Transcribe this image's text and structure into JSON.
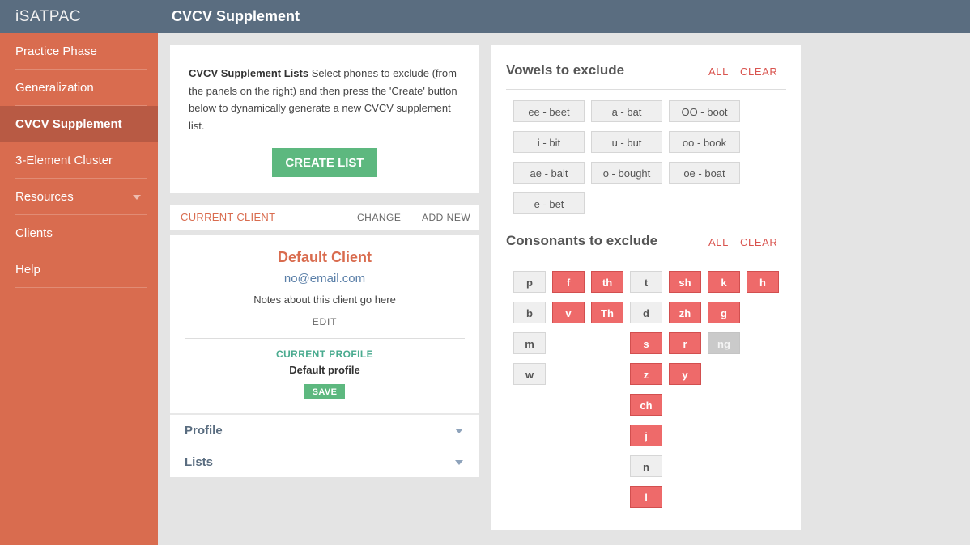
{
  "app": {
    "brand": "iSATPAC",
    "page_title": "CVCV Supplement"
  },
  "sidebar": {
    "items": [
      {
        "label": "Practice Phase",
        "active": false
      },
      {
        "label": "Generalization",
        "active": false
      },
      {
        "label": "CVCV Supplement",
        "active": true
      },
      {
        "label": "3-Element Cluster",
        "active": false
      },
      {
        "label": "Resources",
        "active": false,
        "has_dropdown": true
      },
      {
        "label": "Clients",
        "active": false
      },
      {
        "label": "Help",
        "active": false
      }
    ]
  },
  "intro": {
    "heading": "CVCV Supplement Lists",
    "body": " Select phones to exclude (from the panels on the right) and then press the 'Create' button below to dynamically generate a new CVCV supplement list.",
    "create_label": "CREATE LIST"
  },
  "client_bar": {
    "label": "CURRENT CLIENT",
    "change_label": "CHANGE",
    "add_label": "ADD NEW"
  },
  "client": {
    "name": "Default Client",
    "email": "no@email.com",
    "notes": "Notes about this client go here",
    "edit_label": "EDIT",
    "profile_label": "CURRENT PROFILE",
    "profile_name": "Default profile",
    "save_label": "SAVE",
    "accordion": [
      "Profile",
      "Lists"
    ]
  },
  "vowels": {
    "title": "Vowels to exclude",
    "all_label": "ALL",
    "clear_label": "CLEAR",
    "items": [
      "ee - beet",
      "a - bat",
      "OO - boot",
      "i - bit",
      "u - but",
      "oo - book",
      "ae - bait",
      "o - bought",
      "oe - boat",
      "e - bet"
    ]
  },
  "consonants": {
    "title": "Consonants to exclude",
    "all_label": "ALL",
    "clear_label": "CLEAR",
    "columns": [
      [
        {
          "label": "p",
          "state": "normal"
        },
        {
          "label": "b",
          "state": "normal"
        },
        {
          "label": "m",
          "state": "normal"
        },
        {
          "label": "w",
          "state": "normal"
        }
      ],
      [
        {
          "label": "f",
          "state": "selected"
        },
        {
          "label": "v",
          "state": "selected"
        }
      ],
      [
        {
          "label": "th",
          "state": "selected"
        },
        {
          "label": "Th",
          "state": "selected"
        }
      ],
      [
        {
          "label": "t",
          "state": "normal"
        },
        {
          "label": "d",
          "state": "normal"
        },
        {
          "label": "s",
          "state": "selected"
        },
        {
          "label": "z",
          "state": "selected"
        },
        {
          "label": "ch",
          "state": "selected"
        },
        {
          "label": "j",
          "state": "selected"
        },
        {
          "label": "n",
          "state": "normal"
        },
        {
          "label": "l",
          "state": "selected"
        }
      ],
      [
        {
          "label": "sh",
          "state": "selected"
        },
        {
          "label": "zh",
          "state": "selected"
        },
        {
          "label": "r",
          "state": "selected"
        },
        {
          "label": "y",
          "state": "selected"
        }
      ],
      [
        {
          "label": "k",
          "state": "selected"
        },
        {
          "label": "g",
          "state": "selected"
        },
        {
          "label": "ng",
          "state": "disabled"
        }
      ],
      [
        {
          "label": "h",
          "state": "selected"
        }
      ]
    ]
  },
  "colors": {
    "topbar": "#5a6d80",
    "sidebar": "#d96c4f",
    "sidebar_active": "#b85a44",
    "accent_green": "#5db87f",
    "chip_selected": "#ee6a6a",
    "chip_disabled": "#cacaca"
  }
}
